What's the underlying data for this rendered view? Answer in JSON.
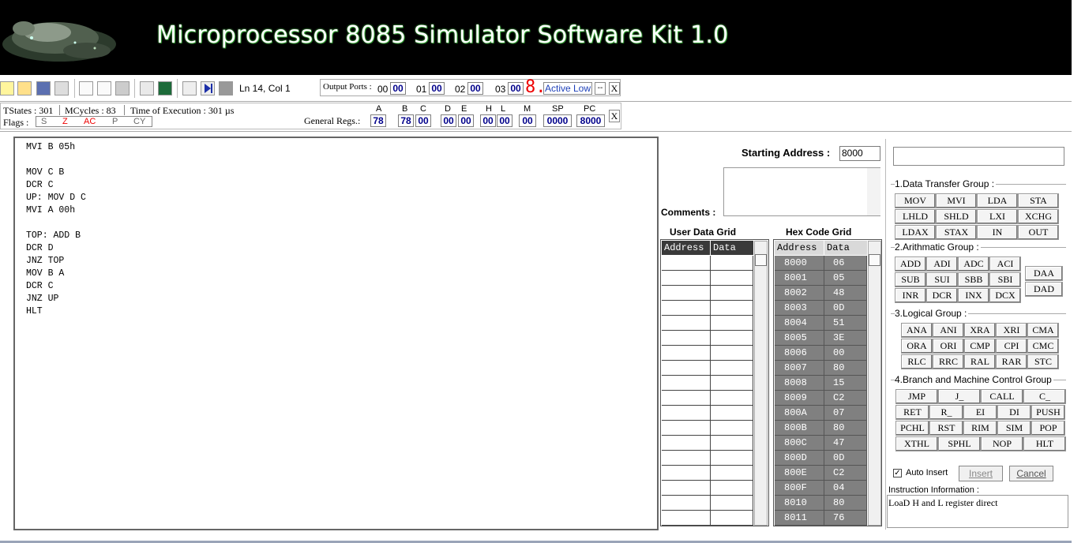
{
  "app": {
    "title": "Microprocessor 8085 Simulator Software Kit 1.0"
  },
  "toolbar": {
    "cursor_pos": "Ln 14, Col 1",
    "output_ports_label": "Output Ports :",
    "ports": [
      {
        "num": "00",
        "val": "00"
      },
      {
        "num": "01",
        "val": "00"
      },
      {
        "num": "02",
        "val": "00"
      },
      {
        "num": "03",
        "val": "00"
      }
    ],
    "seven_seg": "8.",
    "active_mode": "Active Low",
    "minus": "--",
    "close": "X"
  },
  "status": {
    "tstates": "TStates : 301",
    "mcycles": "MCycles : 83",
    "time": "Time of Execution : 301 µs",
    "flags_label": "Flags :",
    "flags": [
      {
        "name": "S",
        "active": false
      },
      {
        "name": "Z",
        "active": true
      },
      {
        "name": "AC",
        "active": true
      },
      {
        "name": "P",
        "active": false
      },
      {
        "name": "CY",
        "active": false
      }
    ],
    "general_regs_label": "General Regs.:",
    "close": "X"
  },
  "registers": [
    {
      "name": "A",
      "value": "78"
    },
    {
      "name": "B",
      "value": "78"
    },
    {
      "name": "C",
      "value": "00"
    },
    {
      "name": "D",
      "value": "00"
    },
    {
      "name": "E",
      "value": "00"
    },
    {
      "name": "H",
      "value": "00"
    },
    {
      "name": "L",
      "value": "00"
    },
    {
      "name": "M",
      "value": "00"
    },
    {
      "name": "SP",
      "value": "0000"
    },
    {
      "name": "PC",
      "value": "8000"
    }
  ],
  "editor": {
    "code": "MVI B 05h\n\nMOV C B\nDCR C\nUP: MOV D C\nMVI A 00h\n\nTOP: ADD B\nDCR D\nJNZ TOP\nMOV B A\nDCR C\nJNZ UP\nHLT"
  },
  "start": {
    "label": "Starting Address :",
    "value": "8000"
  },
  "comments": {
    "label": "Comments :"
  },
  "user_grid": {
    "title": "User Data Grid",
    "cols": [
      "Address",
      "Data"
    ]
  },
  "hex_grid": {
    "title": "Hex Code Grid",
    "cols": [
      "Address",
      "Data"
    ],
    "rows": [
      [
        "8000",
        "06"
      ],
      [
        "8001",
        "05"
      ],
      [
        "8002",
        "48"
      ],
      [
        "8003",
        "0D"
      ],
      [
        "8004",
        "51"
      ],
      [
        "8005",
        "3E"
      ],
      [
        "8006",
        "00"
      ],
      [
        "8007",
        "80"
      ],
      [
        "8008",
        "15"
      ],
      [
        "8009",
        "C2"
      ],
      [
        "800A",
        "07"
      ],
      [
        "800B",
        "80"
      ],
      [
        "800C",
        "47"
      ],
      [
        "800D",
        "0D"
      ],
      [
        "800E",
        "C2"
      ],
      [
        "800F",
        "04"
      ],
      [
        "8010",
        "80"
      ],
      [
        "8011",
        "76"
      ]
    ]
  },
  "groups": {
    "g1": "1.Data Transfer Group :",
    "g2": "2.Arithmatic  Group :",
    "g3": "3.Logical  Group :",
    "g4": "4.Branch and Machine Control Group"
  },
  "instr": {
    "g1": [
      "MOV",
      "MVI",
      "LDA",
      "STA",
      "LHLD",
      "SHLD",
      "LXI",
      "XCHG",
      "LDAX",
      "STAX",
      "IN",
      "OUT"
    ],
    "g2": [
      "ADD",
      "ADI",
      "ADC",
      "ACI",
      "SUB",
      "SUI",
      "SBB",
      "SBI",
      "INR",
      "DCR",
      "INX",
      "DCX"
    ],
    "g2x": [
      "DAA",
      "DAD"
    ],
    "g3": [
      "ANA",
      "ANI",
      "XRA",
      "XRI",
      "CMA",
      "ORA",
      "ORI",
      "CMP",
      "CPI",
      "CMC",
      "RLC",
      "RRC",
      "RAL",
      "RAR",
      "STC"
    ],
    "g4": [
      [
        "JMP",
        "J_",
        "CALL",
        "C_"
      ],
      [
        "RET",
        "R_",
        "EI",
        "DI",
        "PUSH"
      ],
      [
        "PCHL",
        "RST",
        "RIM",
        "SIM",
        "POP"
      ],
      [
        "XTHL",
        "SPHL",
        "NOP",
        "HLT"
      ]
    ]
  },
  "auto_insert": {
    "label": "Auto Insert",
    "checked": true
  },
  "buttons": {
    "insert": "Insert",
    "cancel": "Cancel"
  },
  "info": {
    "label": "Instruction Information :",
    "text": "LoaD H and L register direct"
  }
}
